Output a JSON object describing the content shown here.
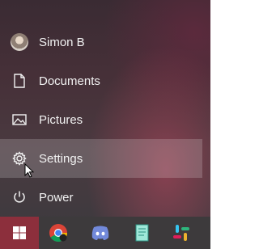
{
  "menu": {
    "items": [
      {
        "label": "Simon B",
        "icon": "user-avatar"
      },
      {
        "label": "Documents",
        "icon": "document-icon"
      },
      {
        "label": "Pictures",
        "icon": "pictures-icon"
      },
      {
        "label": "Settings",
        "icon": "gear-icon"
      },
      {
        "label": "Power",
        "icon": "power-icon"
      }
    ]
  },
  "taskbar": {
    "items": [
      {
        "name": "start",
        "icon": "windows-logo-icon"
      },
      {
        "name": "chrome",
        "icon": "chrome-icon"
      },
      {
        "name": "discord",
        "icon": "discord-icon"
      },
      {
        "name": "notes-app",
        "icon": "notepad-icon"
      },
      {
        "name": "slack",
        "icon": "slack-icon"
      }
    ]
  },
  "colors": {
    "start_accent": "#8c2f3c",
    "hover_bg": "rgba(255,255,255,0.18)",
    "text": "#f2f2f2"
  }
}
